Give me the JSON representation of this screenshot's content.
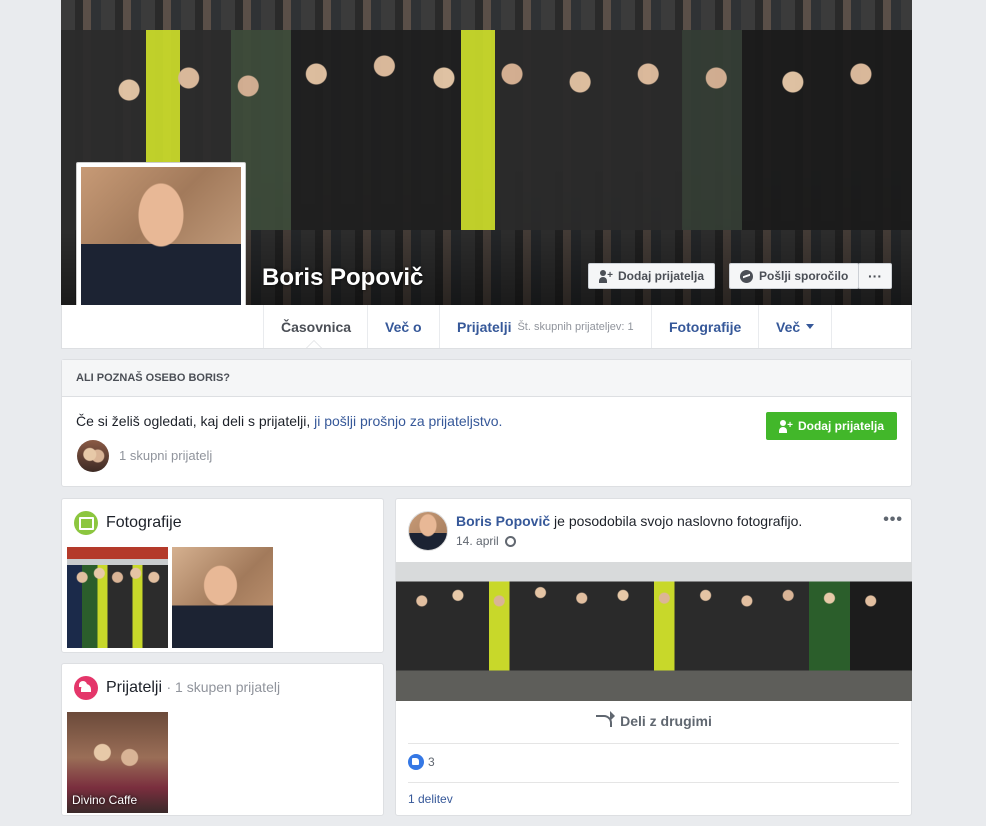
{
  "profile": {
    "name": "Boris Popovič",
    "buttons": {
      "add_friend": "Dodaj prijatelja",
      "send_message": "Pošlji sporočilo",
      "more": "···"
    }
  },
  "nav": {
    "tabs": [
      {
        "label": "Časovnica"
      },
      {
        "label": "Več o"
      },
      {
        "label": "Prijatelji",
        "sub": "Št. skupnih prijateljev: 1"
      },
      {
        "label": "Fotografije"
      },
      {
        "label": "Več"
      }
    ]
  },
  "know_card": {
    "header": "ALI POZNAŠ OSEBO BORIS?",
    "text": "Če si želiš ogledati, kaj deli s prijatelji, ",
    "link": "ji pošlji prošnjo za prijateljstvo.",
    "button": "Dodaj prijatelja",
    "mutual": "1 skupni prijatelj"
  },
  "photos_card": {
    "title": "Fotografije"
  },
  "friends_card": {
    "title": "Prijatelji",
    "sub": "· 1 skupen prijatelj",
    "friend_name": "Divino Caffe"
  },
  "post": {
    "author": "Boris Popovič",
    "action": " je posodobila svojo naslovno fotografijo.",
    "date": "14. april",
    "more": "•••",
    "share_label": "Deli z drugimi",
    "likes": "3",
    "shares": "1 delitev"
  },
  "colors": {
    "link": "#365899",
    "green_button": "#42b72a",
    "background": "#e9ebee"
  }
}
